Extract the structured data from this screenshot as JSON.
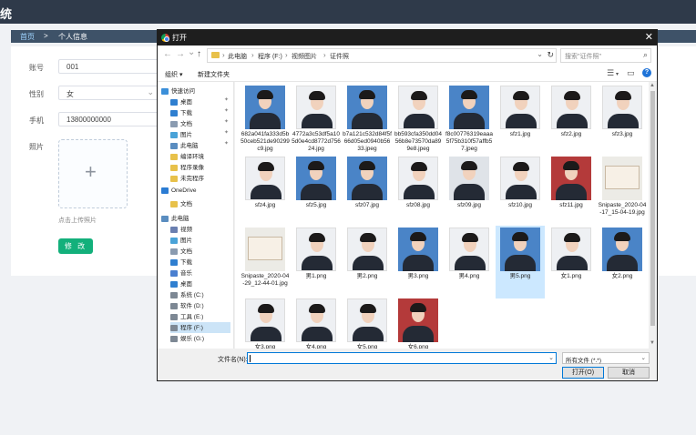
{
  "app": {
    "title": "统",
    "breadcrumb": {
      "home": "首页",
      "separator": ">",
      "current": "个人信息"
    }
  },
  "form": {
    "account_label": "账号",
    "account_value": "001",
    "gender_label": "性别",
    "gender_value": "女",
    "phone_label": "手机",
    "phone_value": "13800000000",
    "photo_label": "照片",
    "upload_plus": "+",
    "upload_tip": "点击上传照片",
    "submit_label": "修 改"
  },
  "dialog": {
    "title": "打开",
    "close": "✕",
    "nav": {
      "back": "←",
      "forward": "→",
      "recent": "⌄",
      "up": "↑"
    },
    "address": [
      "此电脑",
      "程序 (F:)",
      "视频图片",
      "证件照"
    ],
    "search_placeholder": "搜索\"证件照\"",
    "toolbar": {
      "organize": "组织 ▾",
      "new_folder": "新建文件夹",
      "help": "?"
    },
    "sidebar": [
      {
        "label": "快速访问",
        "icon": "star-icon",
        "level": 0
      },
      {
        "label": "桌面",
        "icon": "desktop-icon",
        "level": 1,
        "pinned": true
      },
      {
        "label": "下载",
        "icon": "download-icon",
        "level": 1,
        "pinned": true
      },
      {
        "label": "文档",
        "icon": "document-icon",
        "level": 1,
        "pinned": true
      },
      {
        "label": "图片",
        "icon": "picture-icon",
        "level": 1,
        "pinned": true
      },
      {
        "label": "此电脑",
        "icon": "computer-icon",
        "level": 1,
        "pinned": true
      },
      {
        "label": "编译环境",
        "icon": "folder-icon",
        "level": 1
      },
      {
        "label": "程序录像",
        "icon": "folder-icon",
        "level": 1
      },
      {
        "label": "未完程序",
        "icon": "folder-icon",
        "level": 1
      },
      {
        "label": "OneDrive",
        "icon": "cloud-icon",
        "level": 0
      },
      {
        "label": "文档",
        "icon": "folder-icon",
        "level": 1
      },
      {
        "label": "此电脑",
        "icon": "computer-icon",
        "level": 0
      },
      {
        "label": "视频",
        "icon": "video-icon",
        "level": 1
      },
      {
        "label": "图片",
        "icon": "picture-icon",
        "level": 1
      },
      {
        "label": "文档",
        "icon": "document-icon",
        "level": 1
      },
      {
        "label": "下载",
        "icon": "download-icon",
        "level": 1
      },
      {
        "label": "音乐",
        "icon": "music-icon",
        "level": 1
      },
      {
        "label": "桌面",
        "icon": "desktop-icon",
        "level": 1
      },
      {
        "label": "系统 (C:)",
        "icon": "drive-icon",
        "level": 1
      },
      {
        "label": "软件 (D:)",
        "icon": "drive-icon",
        "level": 1
      },
      {
        "label": "工具 (E:)",
        "icon": "drive-icon",
        "level": 1
      },
      {
        "label": "程序 (F:)",
        "icon": "drive-icon",
        "level": 1,
        "selected": true
      },
      {
        "label": "娱乐 (G:)",
        "icon": "drive-icon",
        "level": 1
      }
    ],
    "files": [
      {
        "name": "682a041fa333d5b50ceb521de90299c9.jpg",
        "bg": "blue"
      },
      {
        "name": "4772a3c53df5a105d0e4cd8772d75624.jpg",
        "bg": "white"
      },
      {
        "name": "b7a121c532d84f5f66d05ed0940b5633.jpeg",
        "bg": "blue"
      },
      {
        "name": "bb593cfa350dd0456b8e73570da899e8.jpeg",
        "bg": "white"
      },
      {
        "name": "f8c00776319eaaa5f75b310f57affb57.jpeg",
        "bg": "blue"
      },
      {
        "name": "sfz1.jpg",
        "bg": "white"
      },
      {
        "name": "sfz2.jpg",
        "bg": "white"
      },
      {
        "name": "sfz3.jpg",
        "bg": "white"
      },
      {
        "name": "sfz4.jpg",
        "bg": "white"
      },
      {
        "name": "sfz5.jpg",
        "bg": "blue"
      },
      {
        "name": "sfz07.jpg",
        "bg": "blue"
      },
      {
        "name": "sfz08.jpg",
        "bg": "white"
      },
      {
        "name": "sfz09.jpg",
        "bg": "grey"
      },
      {
        "name": "sfz10.jpg",
        "bg": "white"
      },
      {
        "name": "sfz11.jpg",
        "bg": "red"
      },
      {
        "name": "Snipaste_2020-04-17_15-04-19.jpg",
        "bg": "doc"
      },
      {
        "name": "Snipaste_2020-04-29_12-44-01.jpg",
        "bg": "doc"
      },
      {
        "name": "男1.png",
        "bg": "white"
      },
      {
        "name": "男2.png",
        "bg": "white"
      },
      {
        "name": "男3.png",
        "bg": "blue"
      },
      {
        "name": "男4.png",
        "bg": "white"
      },
      {
        "name": "男5.png",
        "bg": "blue",
        "selected": true
      },
      {
        "name": "女1.png",
        "bg": "white"
      },
      {
        "name": "女2.png",
        "bg": "blue"
      },
      {
        "name": "女3.png",
        "bg": "white"
      },
      {
        "name": "女4.png",
        "bg": "white"
      },
      {
        "name": "女5.png",
        "bg": "white"
      },
      {
        "name": "女6.png",
        "bg": "red"
      }
    ],
    "filename_label": "文件名(N):",
    "filename_value": "",
    "filetype_value": "所有文件 (*.*)",
    "open_label": "打开(O)",
    "cancel_label": "取消"
  },
  "colors": {
    "header": "#2f3a4a",
    "accent_green": "#13b07b",
    "selection": "#cce8ff"
  }
}
